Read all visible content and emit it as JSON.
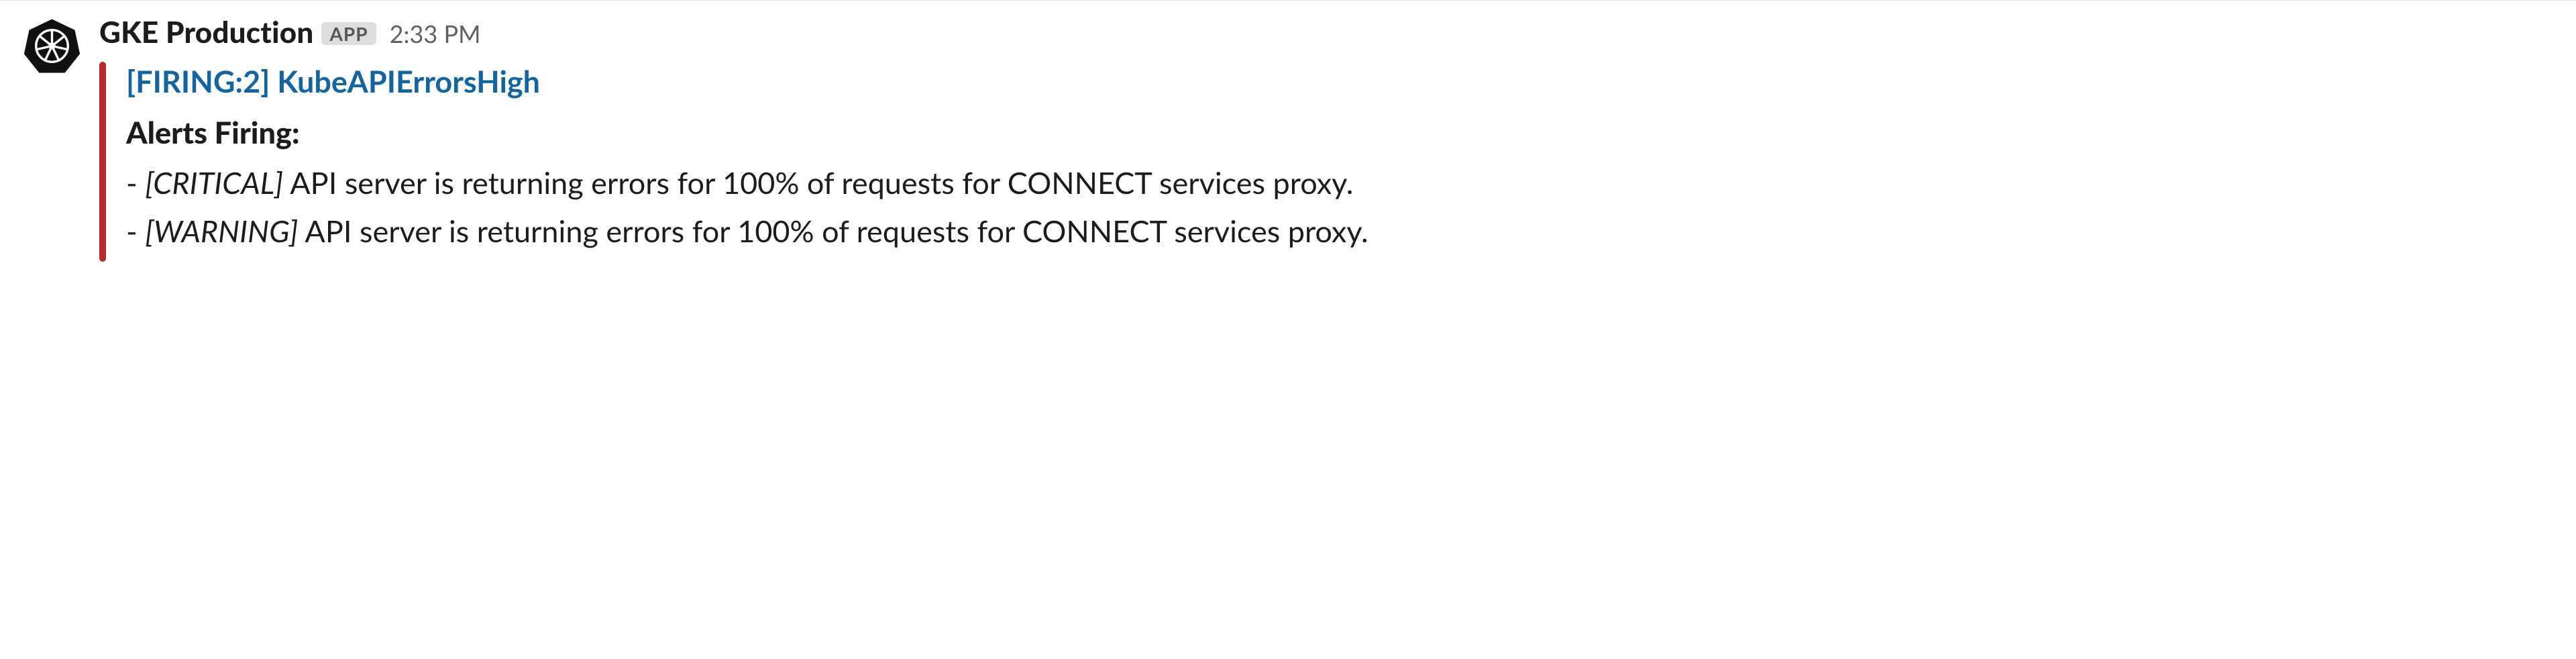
{
  "message": {
    "sender": "GKE Production",
    "badge": "APP",
    "timestamp": "2:33 PM"
  },
  "attachment": {
    "bar_color": "#b72b2b",
    "title": "[FIRING:2] KubeAPIErrorsHigh",
    "heading": "Alerts Firing:",
    "alerts": [
      {
        "severity": "[CRITICAL]",
        "text": " API server is returning errors for 100% of requests for CONNECT services proxy."
      },
      {
        "severity": "[WARNING]",
        "text": " API server is returning errors for 100% of requests for CONNECT services proxy."
      }
    ]
  }
}
